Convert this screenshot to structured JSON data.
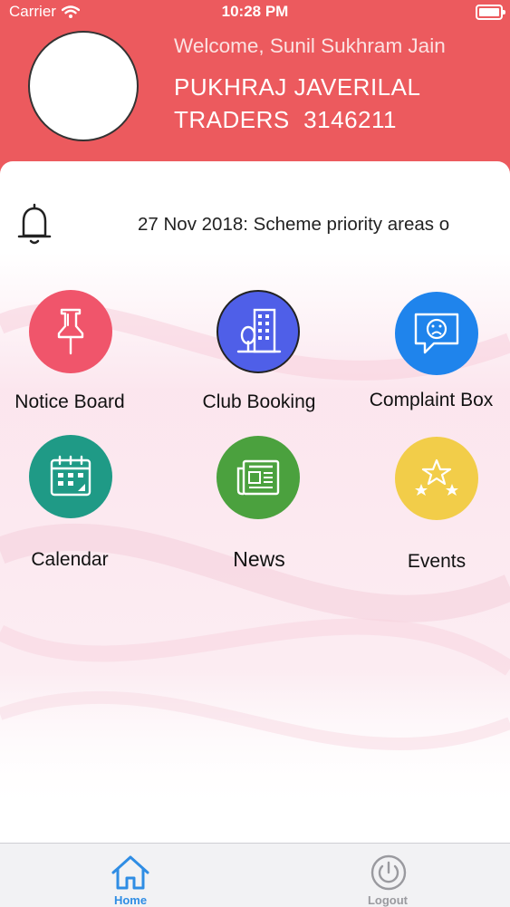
{
  "status_bar": {
    "carrier": "Carrier",
    "time": "10:28 PM"
  },
  "header": {
    "welcome": "Welcome, Sunil Sukhram Jain",
    "company_line1": "PUKHRAJ JAVERILAL",
    "company_line2": "TRADERS  3146211"
  },
  "notice": {
    "ticker": "27 Nov 2018: Scheme priority areas o"
  },
  "tiles": [
    {
      "label": "Notice Board",
      "icon": "pushpin-icon",
      "color": "#f0556b"
    },
    {
      "label": "Club Booking",
      "icon": "building-icon",
      "color": "#4f5fe8"
    },
    {
      "label": "Complaint Box",
      "icon": "complaint-icon",
      "color": "#1f84ec"
    },
    {
      "label": "Calendar",
      "icon": "calendar-icon",
      "color": "#1f9a86"
    },
    {
      "label": "News",
      "icon": "newspaper-icon",
      "color": "#4ba13e"
    },
    {
      "label": "Events",
      "icon": "stars-icon",
      "color": "#f2cd49"
    }
  ],
  "tabbar": {
    "home_label": "Home",
    "logout_label": "Logout",
    "active_color": "#2f8de4",
    "inactive_color": "#9a9a9f"
  }
}
